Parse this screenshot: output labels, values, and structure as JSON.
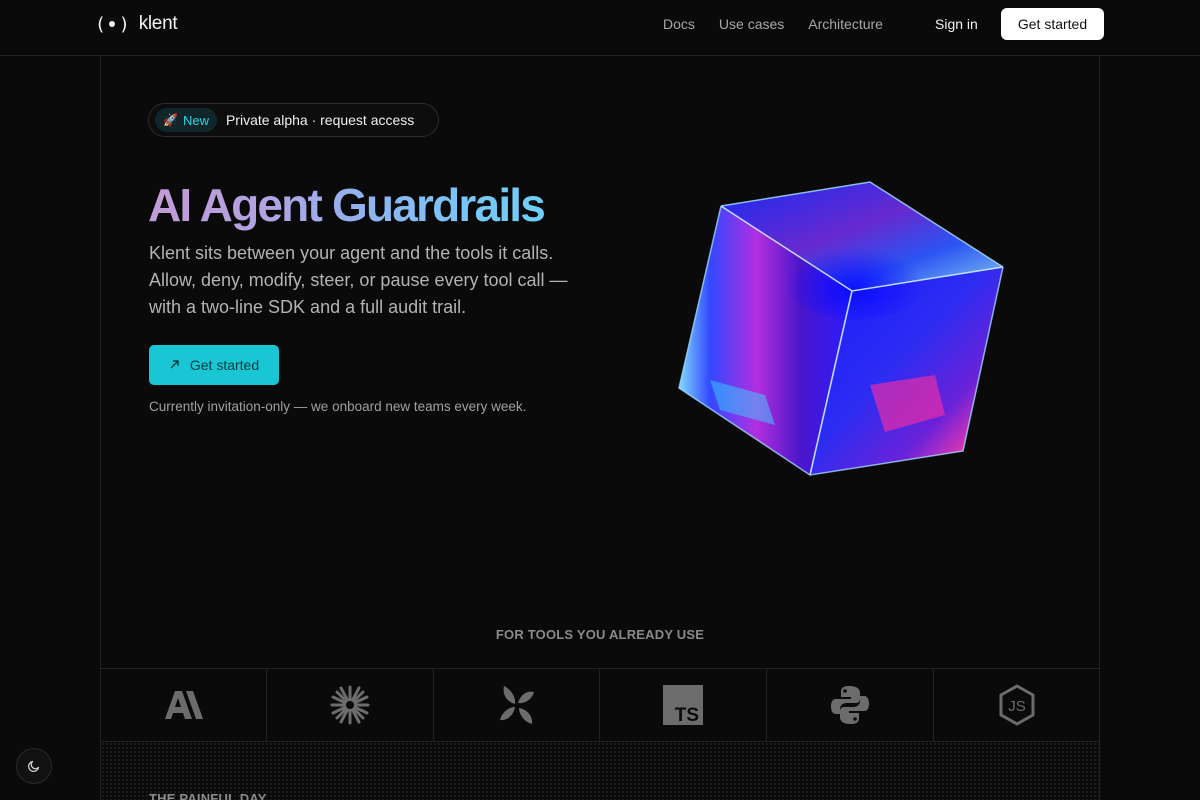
{
  "nav": {
    "brand": "klent",
    "links": [
      "Docs",
      "Use cases",
      "Architecture"
    ],
    "sign_in": "Sign in",
    "cta": "Get started"
  },
  "hero": {
    "badge_icon": "rocket-icon",
    "badge_label": "New",
    "announcement": "Private alpha · request access",
    "title": "AI Agent Guardrails",
    "description": "Klent sits between your agent and the tools it calls. Allow, deny, modify, steer, or pause every tool call — with a two-line SDK and a full audit trail.",
    "cta": "Get started",
    "note": "Currently invitation-only — we onboard new teams every week."
  },
  "tools": {
    "heading": "FOR TOOLS YOU ALREADY USE",
    "logos": [
      "anthropic-logo-icon",
      "claude-burst-logo-icon",
      "petal-logo-icon",
      "typescript-logo-icon",
      "python-logo-icon",
      "nodejs-logo-icon"
    ],
    "ts_text": "TS",
    "js_text": "JS"
  },
  "section": {
    "label": "THE PAINFUL DAY"
  },
  "theme_toggle_icon": "moon-icon",
  "colors": {
    "accent": "#19c7d4",
    "background": "#0a0a0a",
    "title_gradient_start": "#c39bd6",
    "title_gradient_end": "#6ecff7"
  }
}
